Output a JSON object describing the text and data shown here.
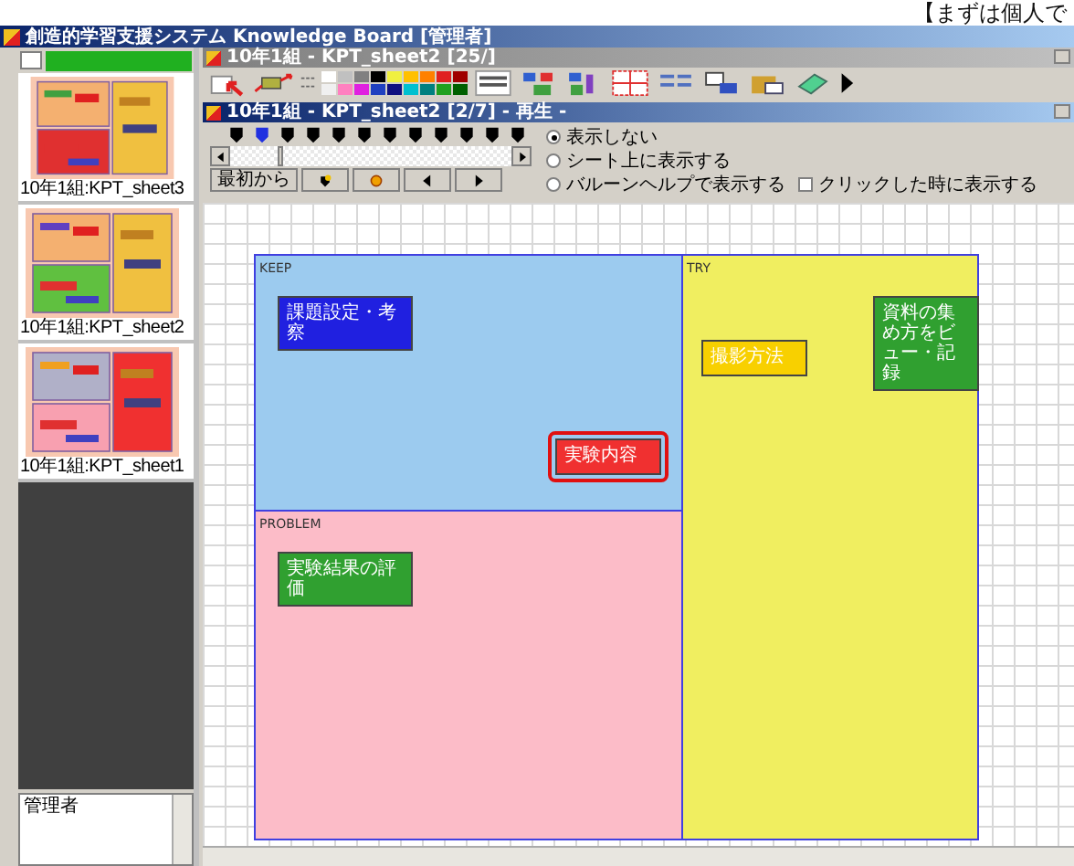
{
  "caption": "【まずは個人で",
  "window": {
    "title": "創造的学習支援システム Knowledge Board [管理者]"
  },
  "sidebar": {
    "sheets": [
      {
        "label": "10年1組:KPT_sheet3"
      },
      {
        "label": "10年1組:KPT_sheet2"
      },
      {
        "label": "10年1組:KPT_sheet1"
      }
    ],
    "user_box": {
      "value": "管理者"
    }
  },
  "editor_window": {
    "title": "10年1組 - KPT_sheet2 [25/]",
    "palette": [
      {
        "color": "#ffffff"
      },
      {
        "color": "#c0c0c0"
      },
      {
        "color": "#808080"
      },
      {
        "color": "#000000"
      },
      {
        "color": "#f0f040"
      },
      {
        "color": "#ffc000"
      },
      {
        "color": "#ff8000"
      },
      {
        "color": "#e02020"
      },
      {
        "color": "#a00000"
      },
      {
        "color": "#f0f0f0"
      },
      {
        "color": "#ff80c0"
      },
      {
        "color": "#e020e0"
      },
      {
        "color": "#2040c0"
      },
      {
        "color": "#101080"
      },
      {
        "color": "#00c0d0"
      },
      {
        "color": "#008080"
      },
      {
        "color": "#20a020"
      },
      {
        "color": "#006000"
      }
    ]
  },
  "player_window": {
    "title": "10年1組 - KPT_sheet2 [2/7] - 再生 -",
    "markers": [
      {
        "selected": false
      },
      {
        "selected": true
      },
      {
        "selected": false
      },
      {
        "selected": false
      },
      {
        "selected": false
      },
      {
        "selected": false
      },
      {
        "selected": false
      },
      {
        "selected": false
      },
      {
        "selected": false
      },
      {
        "selected": false
      },
      {
        "selected": false
      },
      {
        "selected": false
      }
    ],
    "timeline": {
      "level": 0.17
    },
    "start_button": "最初から",
    "display_options": [
      {
        "label": "表示しない",
        "selected": true
      },
      {
        "label": "シート上に表示する",
        "selected": false
      },
      {
        "label": "バルーンヘルプで表示する",
        "selected": false
      }
    ],
    "click_option": {
      "label": "クリックした時に表示する",
      "checked": false
    }
  },
  "board": {
    "sections": [
      {
        "title": "KEEP",
        "color": "#9ccbef",
        "cards": [
          {
            "text": "課題設定・考察",
            "color": "#2020e0",
            "highlighted": false
          },
          {
            "text": "実験内容",
            "color": "#f03030",
            "highlighted": true
          }
        ]
      },
      {
        "title": "TRY",
        "color": "#f0ee60",
        "cards": [
          {
            "text": "撮影方法",
            "color": "#f8d000",
            "highlighted": false
          },
          {
            "text": "資料の集め方をビュー・記録",
            "color": "#30a030",
            "highlighted": false
          }
        ]
      },
      {
        "title": "PROBLEM",
        "color": "#fcbcc8",
        "cards": [
          {
            "text": "実験結果の評価",
            "color": "#30a030",
            "highlighted": false
          }
        ]
      }
    ]
  }
}
